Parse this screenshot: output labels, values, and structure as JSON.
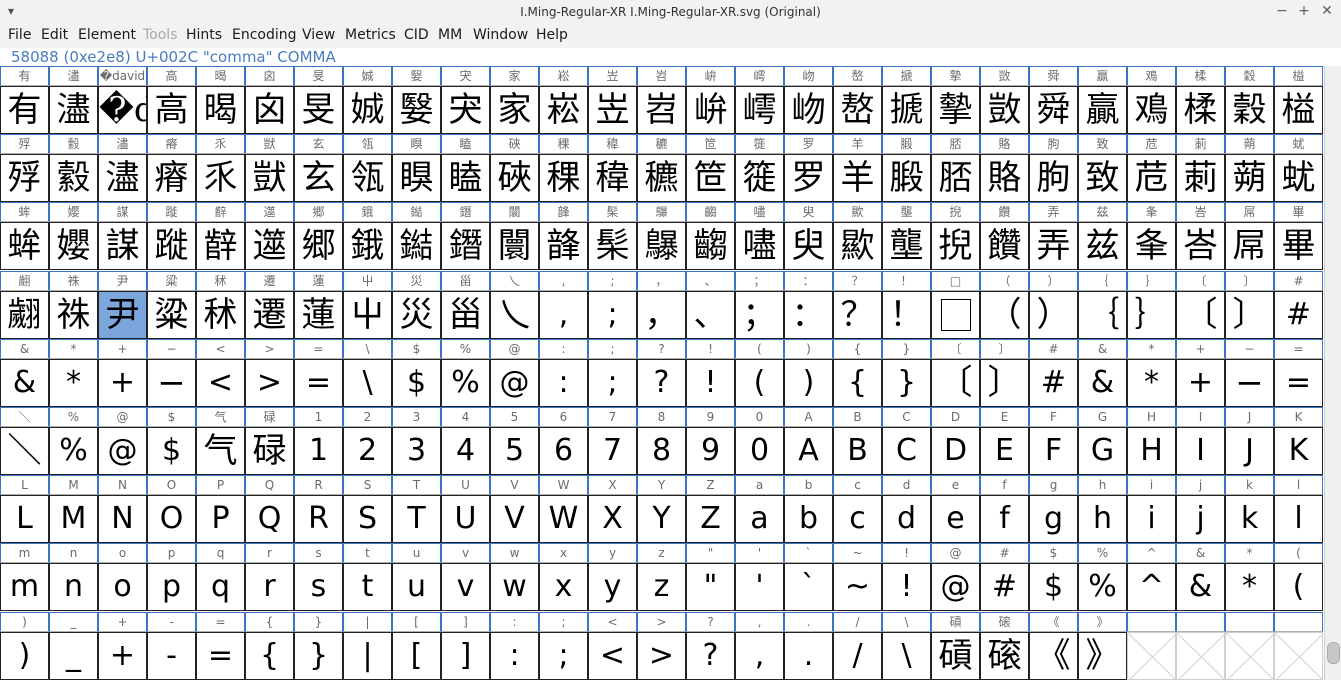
{
  "window": {
    "title": "I.Ming-Regular-XR  I.Ming-Regular-XR.svg (Original)",
    "controls": {
      "minimize": "−",
      "maximize": "+",
      "close": "✕"
    }
  },
  "menu": [
    "File",
    "Edit",
    "Element",
    "Tools",
    "Hints",
    "Encoding",
    "View",
    "Metrics",
    "CID",
    "MM",
    "Window",
    "Help"
  ],
  "menu_disabled": [
    "Tools"
  ],
  "info": "58088 (0xe2e8) U+002C \"comma\" COMMA",
  "selected_index": 83,
  "columns": 27,
  "rows": [
    [
      "有",
      "濜",
      "�david",
      "高",
      "暍",
      "囟",
      "旻",
      "娍",
      "嫛",
      "宊",
      "家",
      "崧",
      "岦",
      "岧",
      "峅",
      "嶀",
      "岉",
      "嶅",
      "搋",
      "摰",
      "敳",
      "舜",
      "贏",
      "鳮",
      "楺",
      "穀",
      "榏"
    ],
    [
      "殍",
      "縠",
      "濜",
      "瘠",
      "乑",
      "獃",
      "玄",
      "瓴",
      "瞁",
      "瞌",
      "硤",
      "稞",
      "稦",
      "穮",
      "笸",
      "簁",
      "罗",
      "羊",
      "腶",
      "脴",
      "賂",
      "朐",
      "致",
      "苊",
      "莿",
      "蒴",
      "蚘"
    ],
    [
      "蛑",
      "孆",
      "謀",
      "蹝",
      "辪",
      "遾",
      "郷",
      "鋨",
      "鐑",
      "鐕",
      "闤",
      "韸",
      "髤",
      "鸔",
      "齺",
      "嚍",
      "臾",
      "歞",
      "壟",
      "掜",
      "饡",
      "弄",
      "兹",
      "夆",
      "峇",
      "屌",
      "畢"
    ],
    [
      "翽",
      "祩",
      "尹",
      "粱",
      "秫",
      "遷",
      "蓮",
      "屮",
      "災",
      "甾",
      "乀",
      ",",
      ";",
      "，",
      "、",
      "；",
      "：",
      "？",
      "！",
      "□",
      "（",
      "）",
      "｛",
      "｝",
      "〔",
      "〕",
      "#"
    ],
    [
      "&",
      "*",
      "+",
      "−",
      "<",
      ">",
      "=",
      "\\",
      "$",
      "%",
      "@",
      ":",
      ";",
      "?",
      "!",
      "(",
      ")",
      "{",
      "}",
      "〔",
      "〕",
      "#",
      "&",
      "*",
      "+",
      "−",
      "="
    ],
    [
      "＼",
      "%",
      "@",
      "$",
      "气",
      "碌",
      "1",
      "2",
      "3",
      "4",
      "5",
      "6",
      "7",
      "8",
      "9",
      "0",
      "A",
      "B",
      "C",
      "D",
      "E",
      "F",
      "G",
      "H",
      "I",
      "J",
      "K"
    ],
    [
      "L",
      "M",
      "N",
      "O",
      "P",
      "Q",
      "R",
      "S",
      "T",
      "U",
      "V",
      "W",
      "X",
      "Y",
      "Z",
      "a",
      "b",
      "c",
      "d",
      "e",
      "f",
      "g",
      "h",
      "i",
      "j",
      "k",
      "l"
    ],
    [
      "m",
      "n",
      "o",
      "p",
      "q",
      "r",
      "s",
      "t",
      "u",
      "v",
      "w",
      "x",
      "y",
      "z",
      "\"",
      "'",
      "`",
      "~",
      "!",
      "@",
      "#",
      "$",
      "%",
      "^",
      "&",
      "*",
      "("
    ],
    [
      ")",
      "_",
      "+",
      "-",
      "=",
      "{",
      "}",
      "|",
      "[",
      "]",
      ":",
      ";",
      "<",
      ">",
      "?",
      ",",
      ".",
      "/",
      "\\",
      "碽",
      "磙",
      "《",
      "》",
      "",
      "",
      "",
      ""
    ]
  ]
}
